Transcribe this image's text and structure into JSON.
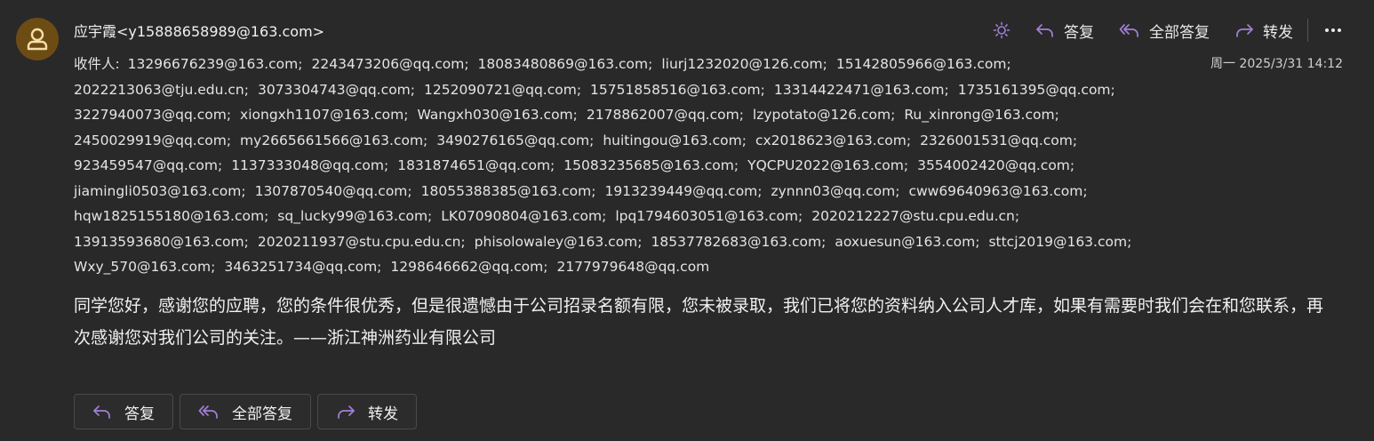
{
  "email": {
    "sender": "应宇霞<y15888658989@163.com>",
    "datetime": "周一 2025/3/31 14:12",
    "recipients_label": "收件人:",
    "recipients": [
      "13296676239@163.com;",
      "2243473206@qq.com;",
      "18083480869@163.com;",
      "liurj1232020@126.com;",
      "15142805966@163.com;",
      "2022213063@tju.edu.cn;",
      "3073304743@qq.com;",
      "1252090721@qq.com;",
      "15751858516@163.com;",
      "13314422471@163.com;",
      "1735161395@qq.com;",
      "3227940073@qq.com;",
      "xiongxh1107@163.com;",
      "Wangxh030@163.com;",
      "2178862007@qq.com;",
      "lzypotato@126.com;",
      "Ru_xinrong@163.com;",
      "2450029919@qq.com;",
      "my2665661566@163.com;",
      "3490276165@qq.com;",
      "huitingou@163.com;",
      "cx2018623@163.com;",
      "2326001531@qq.com;",
      "923459547@qq.com;",
      "1137333048@qq.com;",
      "1831874651@qq.com;",
      "15083235685@163.com;",
      "YQCPU2022@163.com;",
      "3554002420@qq.com;",
      "jiamingli0503@163.com;",
      "1307870540@qq.com;",
      "18055388385@163.com;",
      "1913239449@qq.com;",
      "zynnn03@qq.com;",
      "cww69640963@163.com;",
      "hqw1825155180@163.com;",
      "sq_lucky99@163.com;",
      "LK07090804@163.com;",
      "lpq1794603051@163.com;",
      "2020212227@stu.cpu.edu.cn;",
      "13913593680@163.com;",
      "2020211937@stu.cpu.edu.cn;",
      "phisolowaley@163.com;",
      "18537782683@163.com;",
      "aoxuesun@163.com;",
      "sttcj2019@163.com;",
      "Wxy_570@163.com;",
      "3463251734@qq.com;",
      "1298646662@qq.com;",
      "2177979648@qq.com"
    ],
    "recipient_lines": [
      5,
      6,
      6,
      6,
      6,
      6,
      5,
      6,
      4
    ],
    "body": "同学您好，感谢您的应聘，您的条件很优秀，但是很遗憾由于公司招录名额有限，您未被录取，我们已将您的资料纳入公司人才库，如果有需要时我们会在和您联系，再次感谢您对我们公司的关注。——浙江神洲药业有限公司"
  },
  "toolbar": {
    "reply": "答复",
    "reply_all": "全部答复",
    "forward": "转发"
  },
  "bottom": {
    "reply": "答复",
    "reply_all": "全部答复",
    "forward": "转发"
  },
  "icons": {
    "avatar": "person-icon",
    "theme": "sun-icon",
    "reply": "reply-icon",
    "reply_all": "reply-all-icon",
    "forward": "forward-icon",
    "more": "more-icon"
  },
  "colors": {
    "background": "#292929",
    "accent": "#a37fd6",
    "avatar_bg": "#6d4c14",
    "avatar_fg": "#f5dfa8"
  }
}
